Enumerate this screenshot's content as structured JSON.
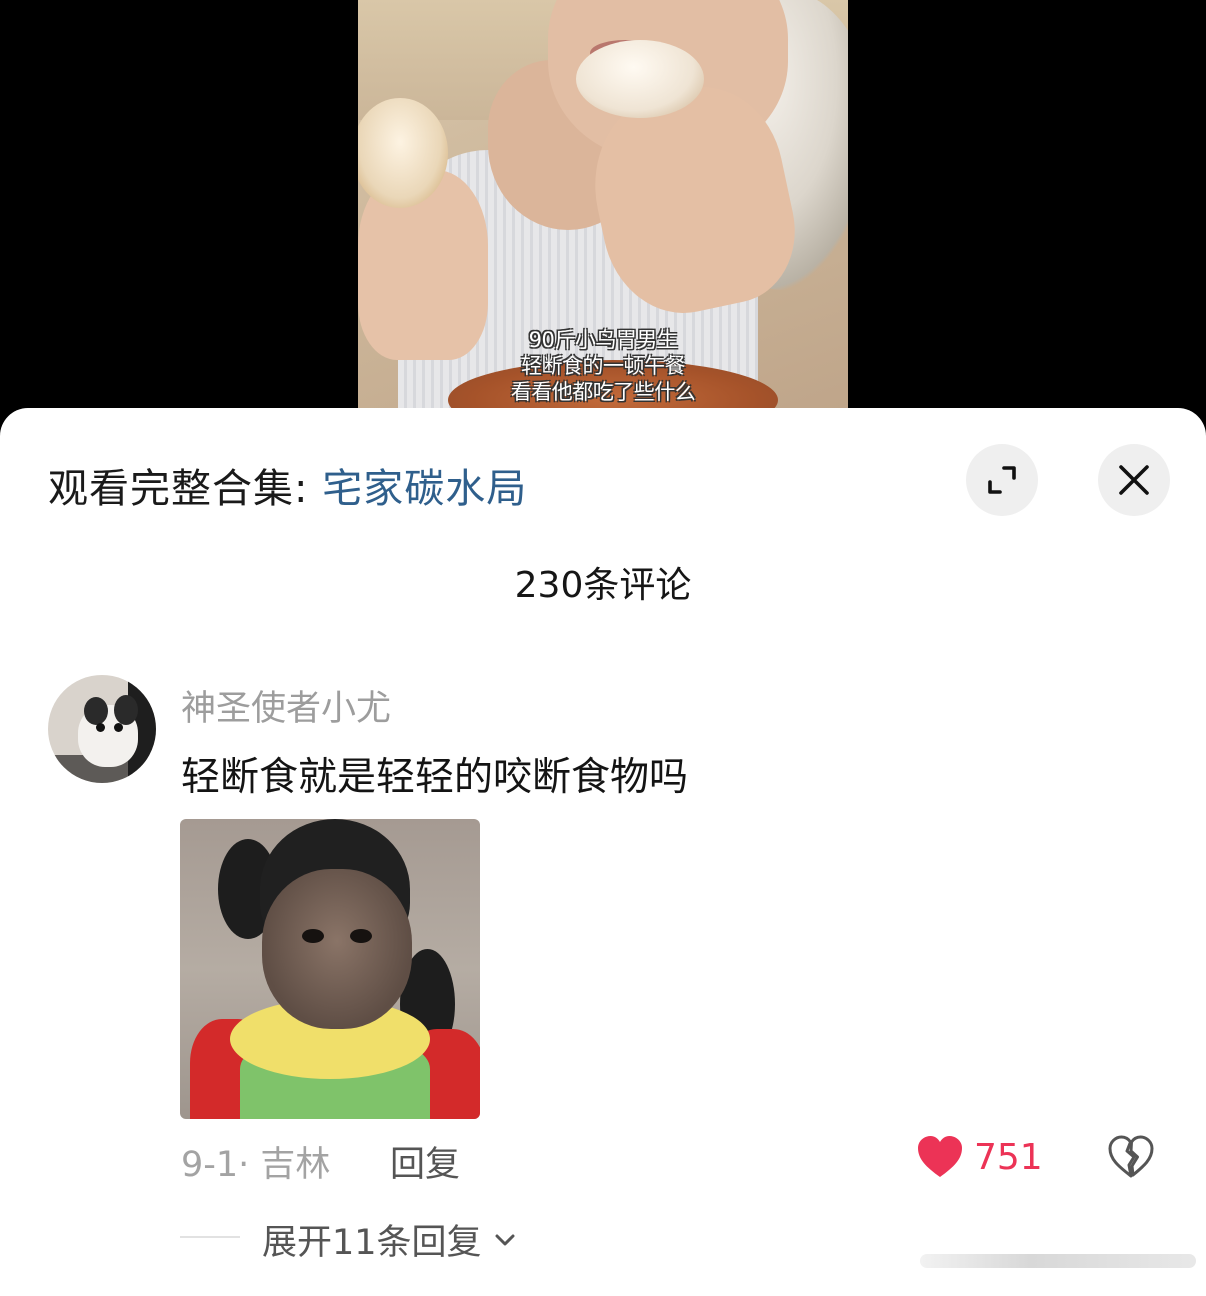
{
  "video": {
    "caption_line1": "90斤小鸟胃男生",
    "caption_line2": "轻断食的一顿午餐",
    "caption_line3": "看看他都吃了些什么"
  },
  "sheet": {
    "collection_prefix": "观看完整合集: ",
    "collection_name": "宅家碳水局",
    "comment_count_label": "230条评论",
    "expand_icon": "expand-icon",
    "close_icon": "close-icon"
  },
  "comment": {
    "username": "神圣使者小尤",
    "text": "轻断食就是轻轻的咬断食物吗",
    "meta": "9-1· 吉林",
    "reply_label": "回复",
    "like_count": "751",
    "like_icon": "heart-filled-icon",
    "dislike_icon": "broken-heart-icon",
    "expand_replies_label": "展开11条回复"
  },
  "colors": {
    "link": "#2f5f8c",
    "like": "#ec3356",
    "muted": "#9d9d9d"
  }
}
